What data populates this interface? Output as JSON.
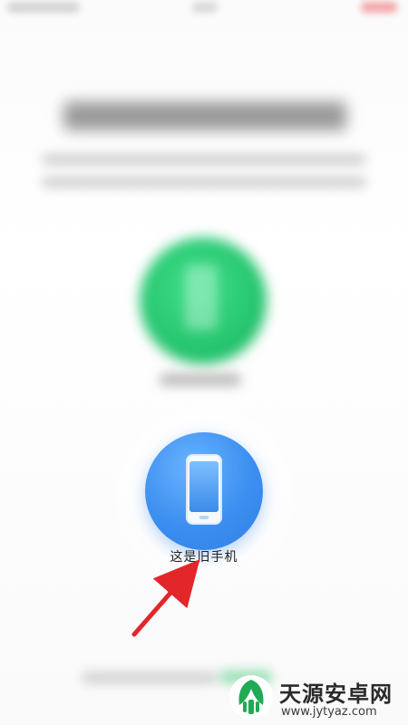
{
  "old_phone": {
    "label": "这是旧手机",
    "icon": "phone-icon",
    "color": "#3c8ff0"
  },
  "new_phone": {
    "icon": "phone-icon",
    "color": "#22c06a"
  },
  "annotation": {
    "color": "#e3262a"
  },
  "watermark": {
    "name": "天源安卓网",
    "url": "www.jytyaz.com"
  }
}
